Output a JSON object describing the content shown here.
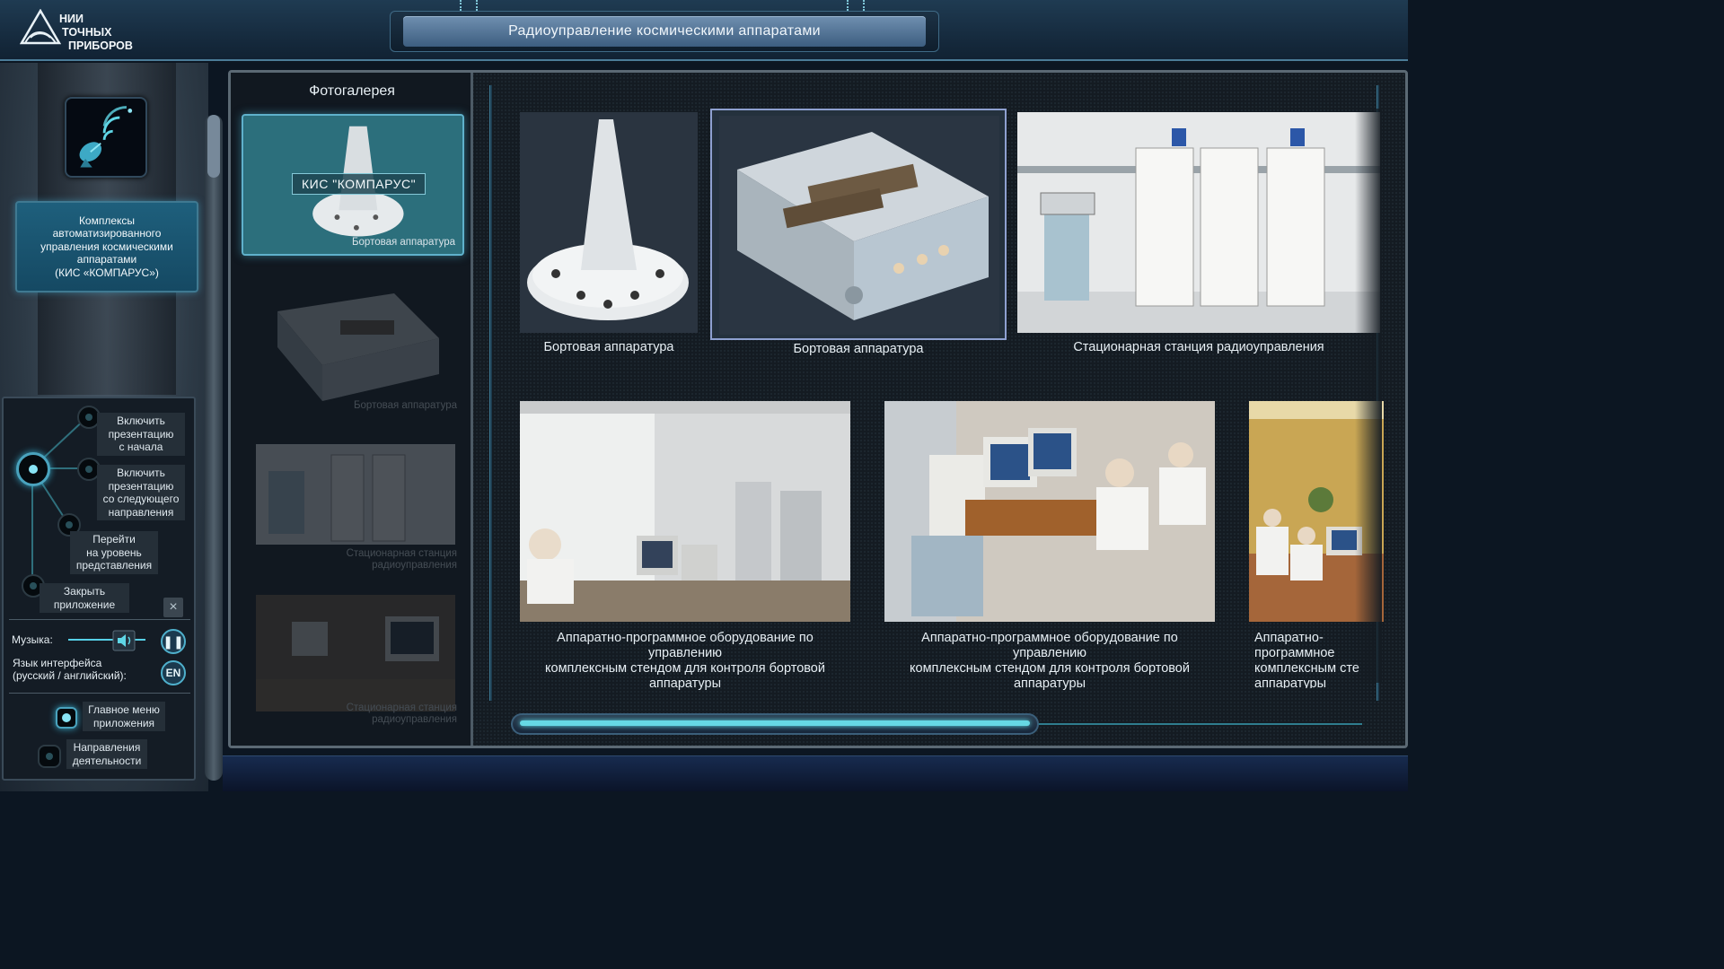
{
  "header": {
    "logo_lines": [
      "НИИ",
      "ТОЧНЫХ",
      "ПРИБОРОВ"
    ],
    "title": "Радиоуправление космическими аппаратами"
  },
  "sidebar": {
    "section_card": "Комплексы\nавтоматизированного\nуправления космическими\nаппаратами\n(КИС «КОМПАРУС»)",
    "menu": {
      "restart": "Включить\nпрезентацию\nс начала",
      "next_direction": "Включить\nпрезентацию\nсо следующего\nнаправления",
      "goto_level": "Перейти\nна уровень\nпредставления",
      "close_app": "Закрыть\nприложение",
      "close_icon": "×",
      "music_label": "Музыка:",
      "music_volume": 0.72,
      "pause_glyph": "❚❚",
      "lang_label": "Язык интерфейса\n(русский / английский):",
      "lang_button": "EN",
      "main_menu": "Главное меню\nприложения",
      "directions": "Направления\nдеятельности"
    }
  },
  "gallery": {
    "title": "Фотогалерея",
    "thumbnails": [
      {
        "label": "КИС \"КОМПАРУС\"",
        "caption": "Бортовая аппаратура",
        "selected": true
      },
      {
        "caption": "Бортовая аппаратура",
        "selected": false
      },
      {
        "caption": "Стационарная станция\nрадиоуправления",
        "selected": false
      },
      {
        "caption": "Стационарная станция\nрадиоуправления",
        "selected": false
      }
    ],
    "items": [
      {
        "caption": "Бортовая аппаратура"
      },
      {
        "caption": "Бортовая аппаратура"
      },
      {
        "caption": "Стационарная станция радиоуправления"
      },
      {
        "caption": "Аппаратно-программное оборудование по управлению\nкомплексным стендом для контроля бортовой\nаппаратуры"
      },
      {
        "caption": "Аппаратно-программное оборудование по управлению\nкомплексным стендом для контроля бортовой\nаппаратуры"
      },
      {
        "caption": "Аппаратно-программное\nкомплексным сте\nаппаратуры"
      }
    ],
    "scroll_position": 0.62
  },
  "colors": {
    "accent": "#5fd6e6",
    "header_bg": "#1b3448",
    "panel_bg": "#141b22"
  }
}
